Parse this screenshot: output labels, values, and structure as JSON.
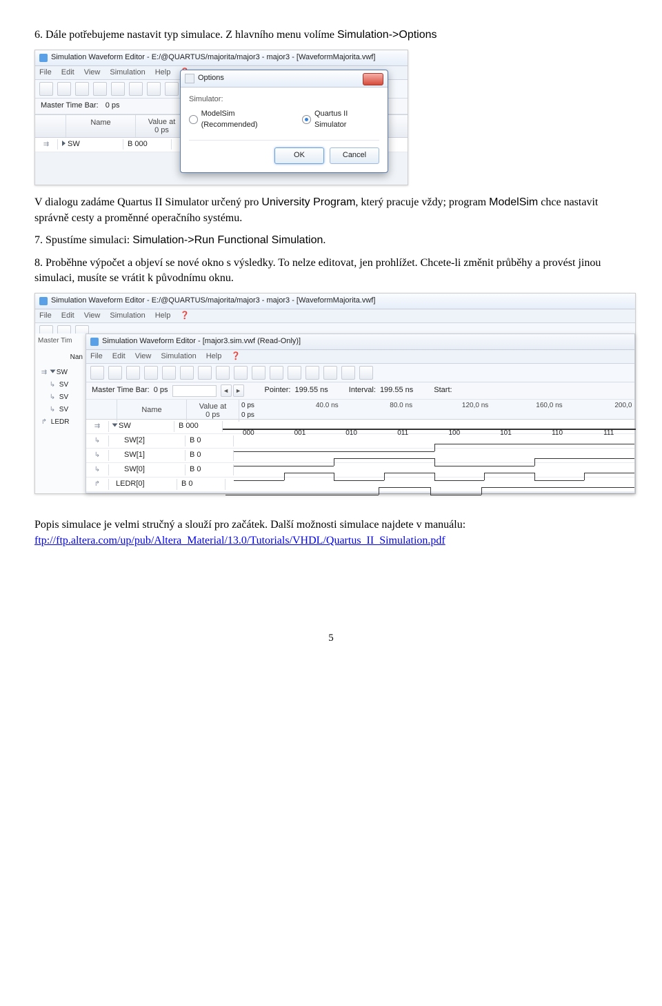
{
  "para1": "6. Dále potřebujeme nastavit typ simulace. Z hlavního menu volíme ",
  "para1_mono": "Simulation->Options",
  "fig1": {
    "title": "Simulation Waveform Editor - E:/@QUARTUS/majorita/major3 - major3 - [WaveformMajorita.vwf]",
    "menus": [
      "File",
      "Edit",
      "View",
      "Simulation",
      "Help"
    ],
    "timebar_label": "Master Time Bar:",
    "timebar_value": "0 ps",
    "col_name": "Name",
    "col_value_top": "Value at",
    "col_value_bot": "0 ps",
    "sig_name": "SW",
    "sig_val": "B 000",
    "dlg_title": "Options",
    "dlg_lbl": "Simulator:",
    "dlg_radio1": "ModelSim (Recommended)",
    "dlg_radio2": "Quartus II Simulator",
    "dlg_ok": "OK",
    "dlg_cancel": "Cancel"
  },
  "para2a": "V dialogu zadáme Quartus II Simulator určený pro ",
  "para2b_mono": "University Program",
  "para2c": ", který pracuje vždy; program ",
  "para2d_mono": "ModelSim",
  "para2e": " chce nastavit správně cesty a proměnné operačního systému.",
  "para3a": "7. Spustíme simulaci: ",
  "para3b_mono": "Simulation->Run Functional Simulation",
  "para3c": ".",
  "para4": "8. Proběhne výpočet a objeví se nové okno s výsledky. To nelze editovat, jen prohlížet. Chcete-li změnit průběhy a provést jinou simulaci, musíte se vrátit k původnímu oknu.",
  "fig2": {
    "outer_title": "Simulation Waveform Editor - E:/@QUARTUS/majorita/major3 - major3 - [WaveformMajorita.vwf]",
    "outer_menus": [
      "File",
      "Edit",
      "View",
      "Simulation",
      "Help"
    ],
    "outer_timebar": "Master Tim",
    "outer_name": "Nan",
    "outer_sigs": [
      "SW",
      "SV",
      "SV",
      "SV",
      "LEDR"
    ],
    "inner_title": "Simulation Waveform Editor - [major3.sim.vwf (Read-Only)]",
    "inner_menus": [
      "File",
      "Edit",
      "View",
      "Simulation",
      "Help"
    ],
    "timebar_label": "Master Time Bar:",
    "timebar_value": "0 ps",
    "pointer_lbl": "Pointer:",
    "pointer_val": "199.55 ns",
    "interval_lbl": "Interval:",
    "interval_val": "199.55 ns",
    "start_lbl": "Start:",
    "col_name": "Name",
    "col_value_top": "Value at",
    "col_value_bot": "0 ps",
    "scale_top": "0 ps",
    "scale_bot": "0 ps",
    "ticks": [
      "40.0 ns",
      "80.0 ns",
      "120,0 ns",
      "160,0 ns",
      "200,0"
    ],
    "rows": [
      {
        "name": "SW",
        "val": "B 000",
        "bus": [
          "000",
          "001",
          "010",
          "011",
          "100",
          "101",
          "110",
          "111"
        ],
        "expand": true,
        "ic": "⇉"
      },
      {
        "name": "SW[2]",
        "val": "B 0",
        "ic": "↳"
      },
      {
        "name": "SW[1]",
        "val": "B 0",
        "ic": "↳"
      },
      {
        "name": "SW[0]",
        "val": "B 0",
        "ic": "↳"
      },
      {
        "name": "LEDR[0]",
        "val": "B 0",
        "ic": "↱"
      }
    ]
  },
  "para5a": "Popis simulace je velmi stručný a slouží pro začátek. Další možnosti simulace najdete v manuálu: ",
  "link": "ftp://ftp.altera.com/up/pub/Altera_Material/13.0/Tutorials/VHDL/Quartus_II_Simulation.pdf",
  "page_number": "5"
}
